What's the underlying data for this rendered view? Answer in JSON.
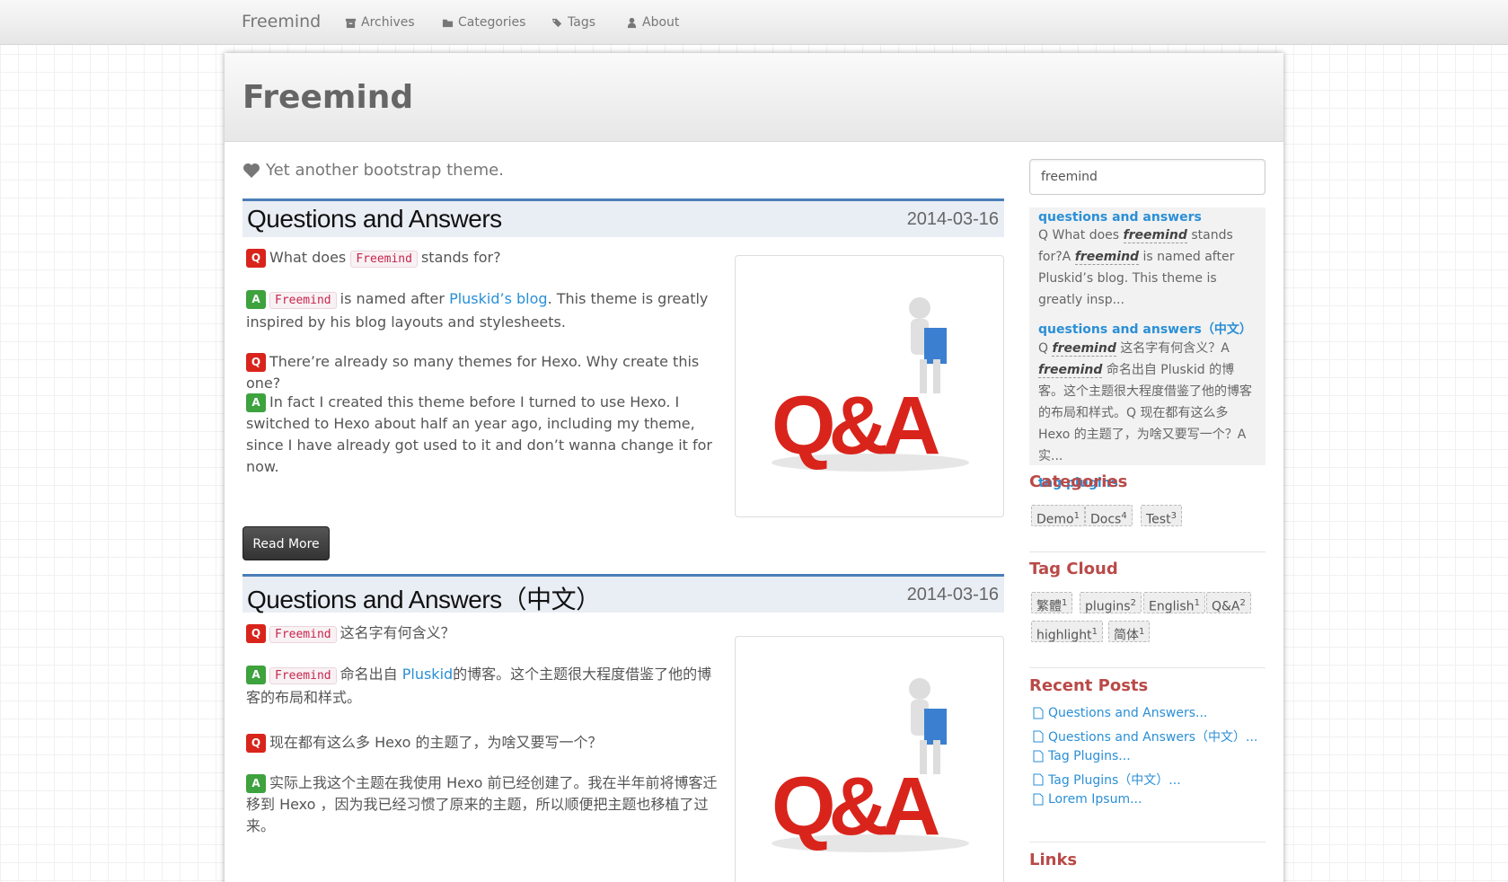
{
  "navbar": {
    "brand": "Freemind",
    "items": [
      {
        "label": "Archives",
        "icon": "archive-icon"
      },
      {
        "label": "Categories",
        "icon": "folder-icon"
      },
      {
        "label": "Tags",
        "icon": "tags-icon"
      },
      {
        "label": "About",
        "icon": "user-icon"
      }
    ]
  },
  "header": {
    "title": "Freemind",
    "tagline": "Yet another bootstrap theme."
  },
  "posts": [
    {
      "title": "Questions and Answers",
      "date": "2014-03-16",
      "q1_pre": "What does",
      "q1_code": "Freemind",
      "q1_post": "stands for?",
      "a1_code": "Freemind",
      "a1_pre": "is named after",
      "a1_link": "Pluskid’s blog",
      "a1_post": ". This theme is greatly inspired by his blog layouts and stylesheets.",
      "q2": "There’re already so many themes for Hexo. Why create this one?",
      "a2": "In fact I created this theme before I turned to use Hexo. I switched to Hexo about half an year ago, including my theme, since I have already got used to it and don’t wanna change it for now.",
      "image_alt": "Q&A"
    },
    {
      "title": "Questions and Answers（中文）",
      "date": "2014-03-16",
      "q1_code": "Freemind",
      "q1_post": "这名字有何含义？",
      "a1_code": "Freemind",
      "a1_pre": "命名出自",
      "a1_link": "Pluskid",
      "a1_post": "的博客。这个主题很大程度借鉴了他的博客的布局和样式。",
      "q2": "现在都有这么多 Hexo 的主题了，为啥又要写一个？",
      "a2": "实际上我这个主题在我使用 Hexo 前已经创建了。我在半年前将博客迁移到 Hexo ，因为我已经习惯了原来的主题，所以顺便把主题也移植了过来。",
      "image_alt": "Q&A"
    }
  ],
  "badges": {
    "q": "Q",
    "a": "A"
  },
  "read_more": "Read More",
  "sidebar": {
    "search_value": "freemind",
    "results": [
      {
        "title": "questions and answers",
        "snippet_a": "Q What does ",
        "em1": "freemind",
        "snippet_b": " stands for?A ",
        "em2": "freemind",
        "snippet_c": " is named after Pluskid’s blog. This theme is greatly insp..."
      },
      {
        "title": "questions and answers（中文）",
        "snippet_a": "Q ",
        "em1": "freemind",
        "snippet_b": " 这名字有何含义？A ",
        "em2": "freemind",
        "snippet_c": " 命名出自 Pluskid 的博客。这个主题很大程度借鉴了他的博客的布局和样式。Q 现在都有这么多 Hexo 的主题了，为啥又要写一个？A 实..."
      },
      {
        "title": "tag plugins"
      }
    ],
    "categories_heading": "Categories",
    "categories": [
      {
        "name": "Demo",
        "count": "1"
      },
      {
        "name": "Docs",
        "count": "4"
      },
      {
        "name": "Test",
        "count": "3"
      }
    ],
    "tagcloud_heading": "Tag Cloud",
    "tags": [
      {
        "name": "繁體",
        "count": "1"
      },
      {
        "name": "plugins",
        "count": "2"
      },
      {
        "name": "English",
        "count": "1"
      },
      {
        "name": "Q&A",
        "count": "2"
      },
      {
        "name": "highlight",
        "count": "1"
      },
      {
        "name": "简体",
        "count": "1"
      }
    ],
    "recent_heading": "Recent Posts",
    "recent": [
      "Questions and Answers...",
      "Questions and Answers（中文）...",
      "Tag Plugins...",
      "Tag Plugins（中文）...",
      "Lorem Ipsum..."
    ],
    "links_heading": "Links"
  },
  "colors": {
    "accent": "#2a8fd6",
    "heading": "#b94a48",
    "post_border": "#4a7fb8"
  }
}
